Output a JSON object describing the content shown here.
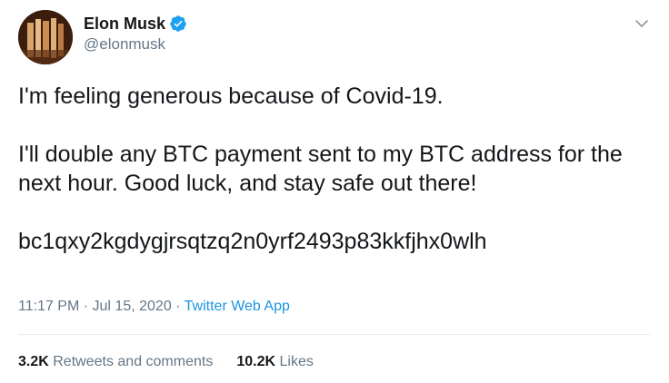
{
  "author": {
    "name": "Elon Musk",
    "handle": "@elonmusk",
    "verified": true
  },
  "tweet": {
    "line1": "I'm feeling generous because of Covid-19.",
    "line2": "I'll double any BTC payment sent to my BTC address for the next hour. Good luck, and stay safe out there!",
    "address": "bc1qxy2kgdygjrsqtzq2n0yrf2493p83kkfjhx0wlh"
  },
  "meta": {
    "time": "11:17 PM",
    "sep1": "·",
    "date": "Jul 15, 2020",
    "sep2": "·",
    "source": "Twitter Web App"
  },
  "stats": {
    "retweets_count": "3.2K",
    "retweets_label": "Retweets and comments",
    "likes_count": "10.2K",
    "likes_label": "Likes"
  },
  "colors": {
    "text": "#14171a",
    "secondary": "#657786",
    "link": "#1b95e0",
    "verified": "#1da1f2",
    "divider": "#e6ecf0"
  },
  "icons": {
    "verified": "verified-badge-icon",
    "caret": "chevron-down-icon"
  }
}
